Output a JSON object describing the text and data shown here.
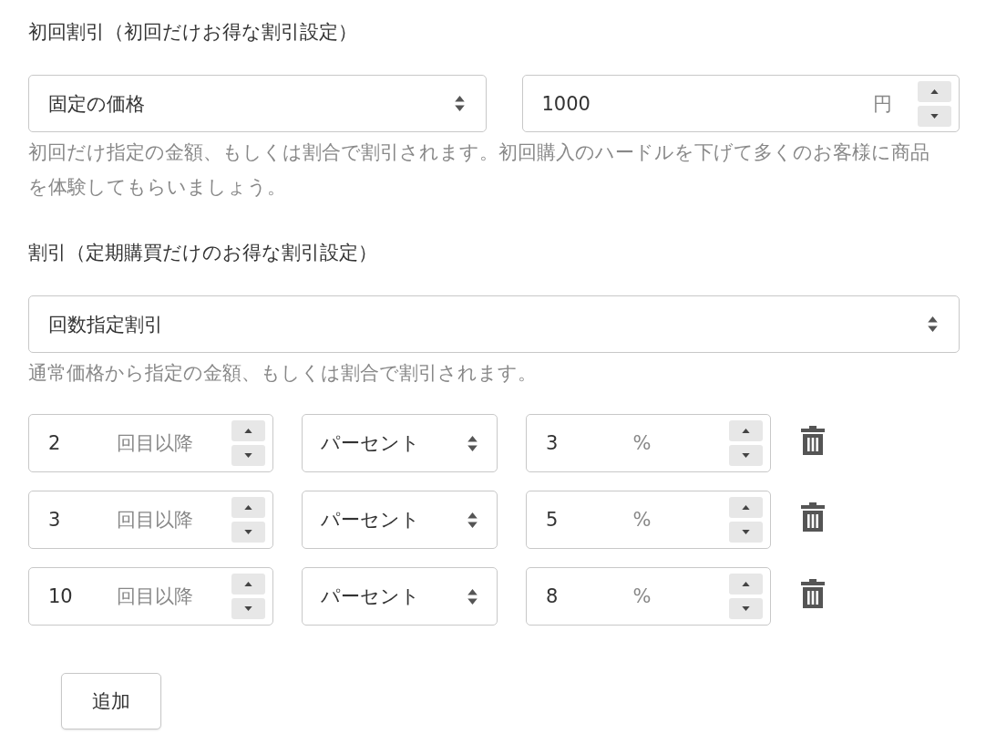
{
  "first_discount": {
    "label": "初回割引（初回だけお得な割引設定）",
    "type_select": {
      "value": "固定の価格"
    },
    "amount_field": {
      "value": "1000",
      "unit": "円"
    },
    "help": "初回だけ指定の金額、もしくは割合で割引されます。初回購入のハードルを下げて多くのお客様に商品を体験してもらいましょう。"
  },
  "discount": {
    "label": "割引（定期購買だけのお得な割引設定）",
    "type_select": {
      "value": "回数指定割引"
    },
    "help": "通常価格から指定の金額、もしくは割合で割引されます。",
    "tiers": [
      {
        "count": "2",
        "count_unit": "回目以降",
        "type": "パーセント",
        "value": "3",
        "unit": "%"
      },
      {
        "count": "3",
        "count_unit": "回目以降",
        "type": "パーセント",
        "value": "5",
        "unit": "%"
      },
      {
        "count": "10",
        "count_unit": "回目以降",
        "type": "パーセント",
        "value": "8",
        "unit": "%"
      }
    ]
  },
  "add_button": "追加"
}
